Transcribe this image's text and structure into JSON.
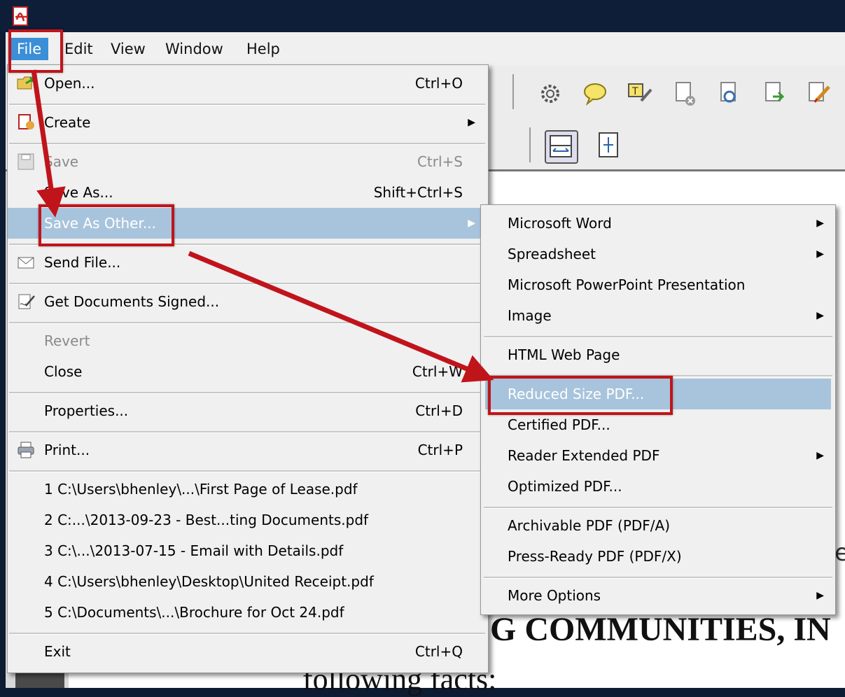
{
  "menubar": {
    "items": [
      "File",
      "Edit",
      "View",
      "Window",
      "Help"
    ]
  },
  "file_menu": {
    "items": [
      {
        "label": "Open...",
        "shortcut": "Ctrl+O",
        "icon": "open-folder-icon"
      },
      {
        "label": "Create",
        "shortcut": "",
        "icon": "create-pdf-icon",
        "submenu": true
      },
      {
        "label": "Save",
        "shortcut": "Ctrl+S",
        "icon": "save-disk-icon",
        "disabled": true
      },
      {
        "label": "Save As...",
        "shortcut": "Shift+Ctrl+S"
      },
      {
        "label": "Save As Other...",
        "shortcut": "",
        "submenu": true,
        "highlighted": true
      },
      {
        "label": "Send File...",
        "shortcut": "",
        "icon": "envelope-icon"
      },
      {
        "label": "Get Documents Signed...",
        "shortcut": "",
        "icon": "sign-document-icon"
      },
      {
        "label": "Revert",
        "shortcut": "",
        "disabled": true
      },
      {
        "label": "Close",
        "shortcut": "Ctrl+W"
      },
      {
        "label": "Properties...",
        "shortcut": "Ctrl+D"
      },
      {
        "label": "Print...",
        "shortcut": "Ctrl+P",
        "icon": "printer-icon"
      },
      {
        "label": "1 C:\\Users\\bhenley\\...\\First Page of Lease.pdf"
      },
      {
        "label": "2 C:...\\2013-09-23 - Best...ting Documents.pdf"
      },
      {
        "label": "3 C:\\...\\2013-07-15 - Email with Details.pdf"
      },
      {
        "label": "4 C:\\Users\\bhenley\\Desktop\\United Receipt.pdf"
      },
      {
        "label": "5 C:\\Documents\\...\\Brochure for Oct 24.pdf"
      },
      {
        "label": "Exit",
        "shortcut": "Ctrl+Q"
      }
    ]
  },
  "submenu": {
    "items": [
      {
        "label": "Microsoft Word",
        "submenu": true
      },
      {
        "label": "Spreadsheet",
        "submenu": true
      },
      {
        "label": "Microsoft PowerPoint Presentation"
      },
      {
        "label": "Image",
        "submenu": true
      },
      {
        "label": "HTML Web Page"
      },
      {
        "label": "Reduced Size PDF...",
        "highlighted": true
      },
      {
        "label": "Certified PDF..."
      },
      {
        "label": "Reader Extended PDF",
        "submenu": true
      },
      {
        "label": "Optimized PDF..."
      },
      {
        "label": "Archivable PDF (PDF/A)"
      },
      {
        "label": "Press-Ready PDF (PDF/X)"
      },
      {
        "label": "More Options",
        "submenu": true
      }
    ]
  },
  "document": {
    "heading": "G COMMUNITIES, IN",
    "line2": "following facts:",
    "fragment": "e"
  },
  "colors": {
    "highlight": "#a8c4dc",
    "annotation_red": "#c0141b",
    "menu_bg": "#f0f0f0",
    "file_active": "#3b8fd6"
  }
}
